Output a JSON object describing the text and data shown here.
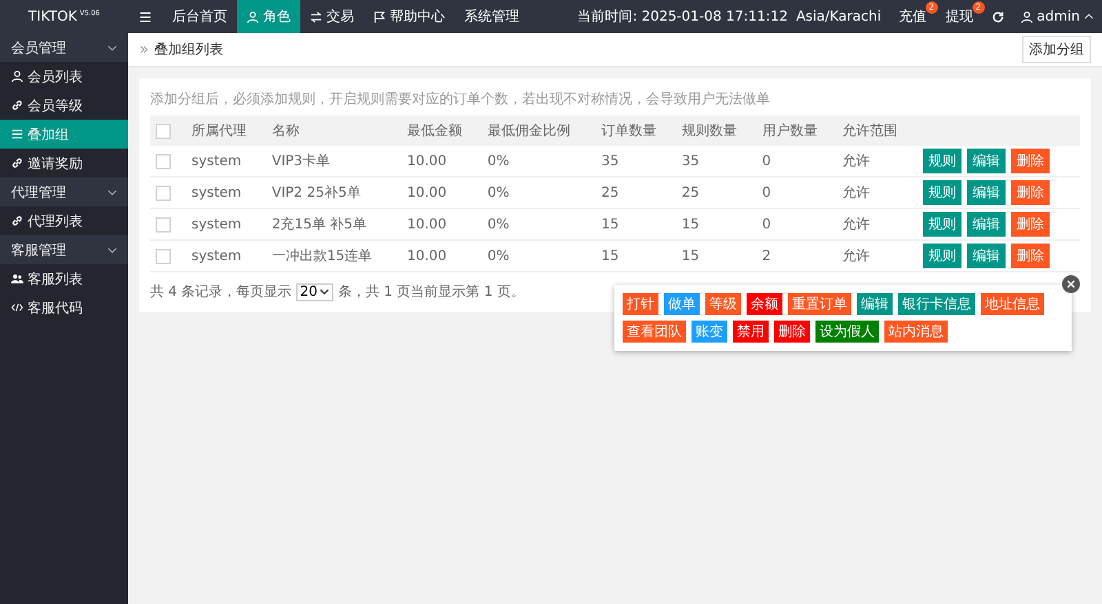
{
  "logo": {
    "name": "TIKTOK",
    "version": "V5.06"
  },
  "top_nav": [
    {
      "label": "后台首页",
      "selected": false
    },
    {
      "label": "角色",
      "selected": true
    },
    {
      "label": "交易",
      "selected": false
    },
    {
      "label": "帮助中心",
      "selected": false
    },
    {
      "label": "系统管理",
      "selected": false
    }
  ],
  "header_right": {
    "clock": "当前时间: 2025-01-08 17:11:12",
    "timezone": "Asia/Karachi",
    "links": [
      {
        "label": "充值",
        "badge": "2"
      },
      {
        "label": "提现",
        "badge": "2"
      }
    ],
    "user": "admin"
  },
  "sidebar": [
    {
      "label": "会员管理",
      "expanded": true,
      "children": [
        {
          "label": "会员列表",
          "selected": false
        },
        {
          "label": "会员等级",
          "selected": false
        },
        {
          "label": "叠加组",
          "selected": true
        },
        {
          "label": "邀请奖励",
          "selected": false
        }
      ]
    },
    {
      "label": "代理管理",
      "expanded": true,
      "children": [
        {
          "label": "代理列表",
          "selected": false
        }
      ]
    },
    {
      "label": "客服管理",
      "expanded": true,
      "children": [
        {
          "label": "客服列表",
          "selected": false
        },
        {
          "label": "客服代码",
          "selected": false
        }
      ]
    }
  ],
  "page": {
    "breadcrumb": "叠加组列表",
    "add_button": "添加分组",
    "hint": "添加分组后，必须添加规则，开启规则需要对应的订单个数，若出现不对称情况，会导致用户无法做单"
  },
  "table": {
    "header_checked": false,
    "columns": [
      "所属代理",
      "名称",
      "最低金额",
      "最低佣金比例",
      "订单数量",
      "规则数量",
      "用户数量",
      "允许范围"
    ],
    "rows": [
      {
        "checked": false,
        "cells": [
          "system",
          "VIP3卡单",
          "10.00",
          "0%",
          "35",
          "35",
          "0",
          "允许"
        ],
        "actions": [
          {
            "label": "规则",
            "kind": "primary"
          },
          {
            "label": "编辑",
            "kind": "primary"
          },
          {
            "label": "删除",
            "kind": "danger"
          }
        ]
      },
      {
        "checked": false,
        "cells": [
          "system",
          "VIP2 25补5单",
          "10.00",
          "0%",
          "25",
          "25",
          "0",
          "允许"
        ],
        "actions": [
          {
            "label": "规则",
            "kind": "primary"
          },
          {
            "label": "编辑",
            "kind": "primary"
          },
          {
            "label": "删除",
            "kind": "danger"
          }
        ]
      },
      {
        "checked": false,
        "cells": [
          "system",
          "2充15单 补5单",
          "10.00",
          "0%",
          "15",
          "15",
          "0",
          "允许"
        ],
        "actions": [
          {
            "label": "规则",
            "kind": "primary"
          },
          {
            "label": "编辑",
            "kind": "primary"
          },
          {
            "label": "删除",
            "kind": "danger"
          }
        ]
      },
      {
        "checked": false,
        "cells": [
          "system",
          "一冲出款15连单",
          "10.00",
          "0%",
          "15",
          "15",
          "2",
          "允许"
        ],
        "actions": [
          {
            "label": "规则",
            "kind": "primary"
          },
          {
            "label": "编辑",
            "kind": "primary"
          },
          {
            "label": "删除",
            "kind": "danger"
          }
        ]
      }
    ]
  },
  "pagination": {
    "before": "共 4 条记录，每页显示",
    "page_size": "20",
    "after": "条，共 1 页当前显示第 1 页。"
  },
  "popup": {
    "tags": [
      {
        "label": "打针",
        "color": "#ff5722"
      },
      {
        "label": "做单",
        "color": "#1e9fff"
      },
      {
        "label": "等级",
        "color": "#ff5722"
      },
      {
        "label": "余额",
        "color": "#ff0000"
      },
      {
        "label": "重置订单",
        "color": "#ff5722"
      },
      {
        "label": "编辑",
        "color": "#009688"
      },
      {
        "label": "银行卡信息",
        "color": "#009688"
      },
      {
        "label": "地址信息",
        "color": "#ff5722"
      },
      {
        "label": "查看团队",
        "color": "#ff5722"
      },
      {
        "label": "账变",
        "color": "#1e9fff"
      },
      {
        "label": "禁用",
        "color": "#ff0000"
      },
      {
        "label": "删除",
        "color": "#ff0000"
      },
      {
        "label": "设为假人",
        "color": "#008000"
      },
      {
        "label": "站内消息",
        "color": "#ff5722"
      }
    ]
  }
}
